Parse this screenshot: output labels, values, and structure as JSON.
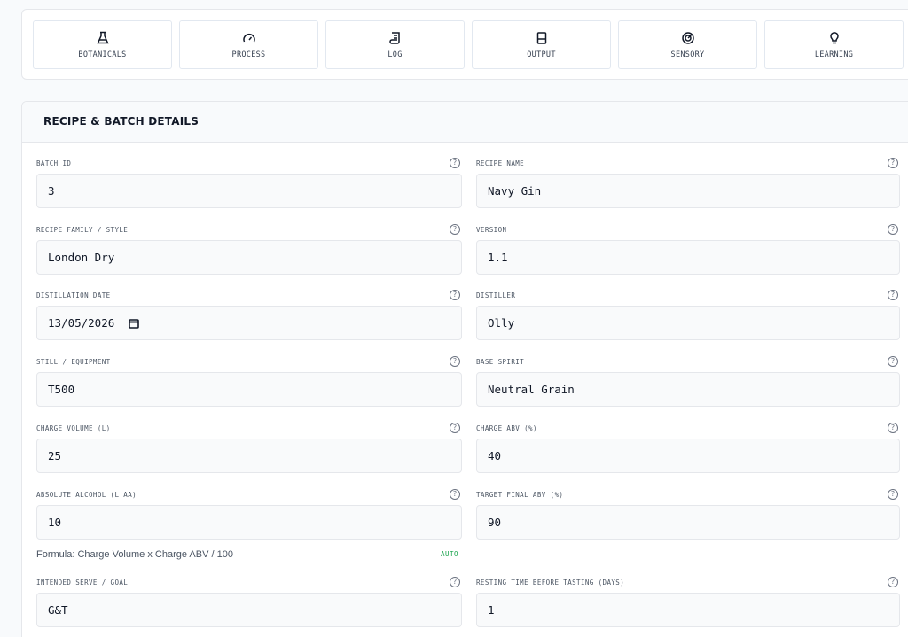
{
  "tabs": [
    {
      "label": "BOTANICALS",
      "icon": "flask-icon"
    },
    {
      "label": "PROCESS",
      "icon": "gauge-icon"
    },
    {
      "label": "LOG",
      "icon": "scroll-icon"
    },
    {
      "label": "OUTPUT",
      "icon": "container-icon"
    },
    {
      "label": "SENSORY",
      "icon": "radar-icon"
    },
    {
      "label": "LEARNING",
      "icon": "lightbulb-icon"
    }
  ],
  "section": {
    "title": "RECIPE & BATCH DETAILS"
  },
  "fields": {
    "batch_id": {
      "label": "BATCH ID",
      "value": "3"
    },
    "recipe_name": {
      "label": "RECIPE NAME",
      "value": "Navy Gin"
    },
    "recipe_family": {
      "label": "RECIPE FAMILY / STYLE",
      "value": "London Dry"
    },
    "version": {
      "label": "VERSION",
      "value": "1.1"
    },
    "distillation_date": {
      "label": "DISTILLATION DATE",
      "value": "13/05/2026"
    },
    "distiller": {
      "label": "DISTILLER",
      "value": "Olly"
    },
    "still": {
      "label": "STILL / EQUIPMENT",
      "value": "T500"
    },
    "base_spirit": {
      "label": "BASE SPIRIT",
      "value": "Neutral Grain"
    },
    "charge_volume": {
      "label": "CHARGE VOLUME (L)",
      "value": "25"
    },
    "charge_abv": {
      "label": "CHARGE ABV (%)",
      "value": "40"
    },
    "absolute_alcohol": {
      "label": "ABSOLUTE ALCOHOL (L AA)",
      "value": "10"
    },
    "target_final_abv": {
      "label": "TARGET FINAL ABV (%)",
      "value": "90"
    },
    "intended_serve": {
      "label": "INTENDED SERVE / GOAL",
      "value": "G&T"
    },
    "resting_time": {
      "label": "RESTING TIME BEFORE TASTING (DAYS)",
      "value": "1"
    }
  },
  "formula": {
    "text": "Formula: Charge Volume x Charge ABV / 100",
    "badge": "AUTO"
  },
  "help_glyph": "?",
  "colors": {
    "accent_green": "#16a34a",
    "input_bg": "#f9fafb",
    "border": "#e5e7eb"
  }
}
